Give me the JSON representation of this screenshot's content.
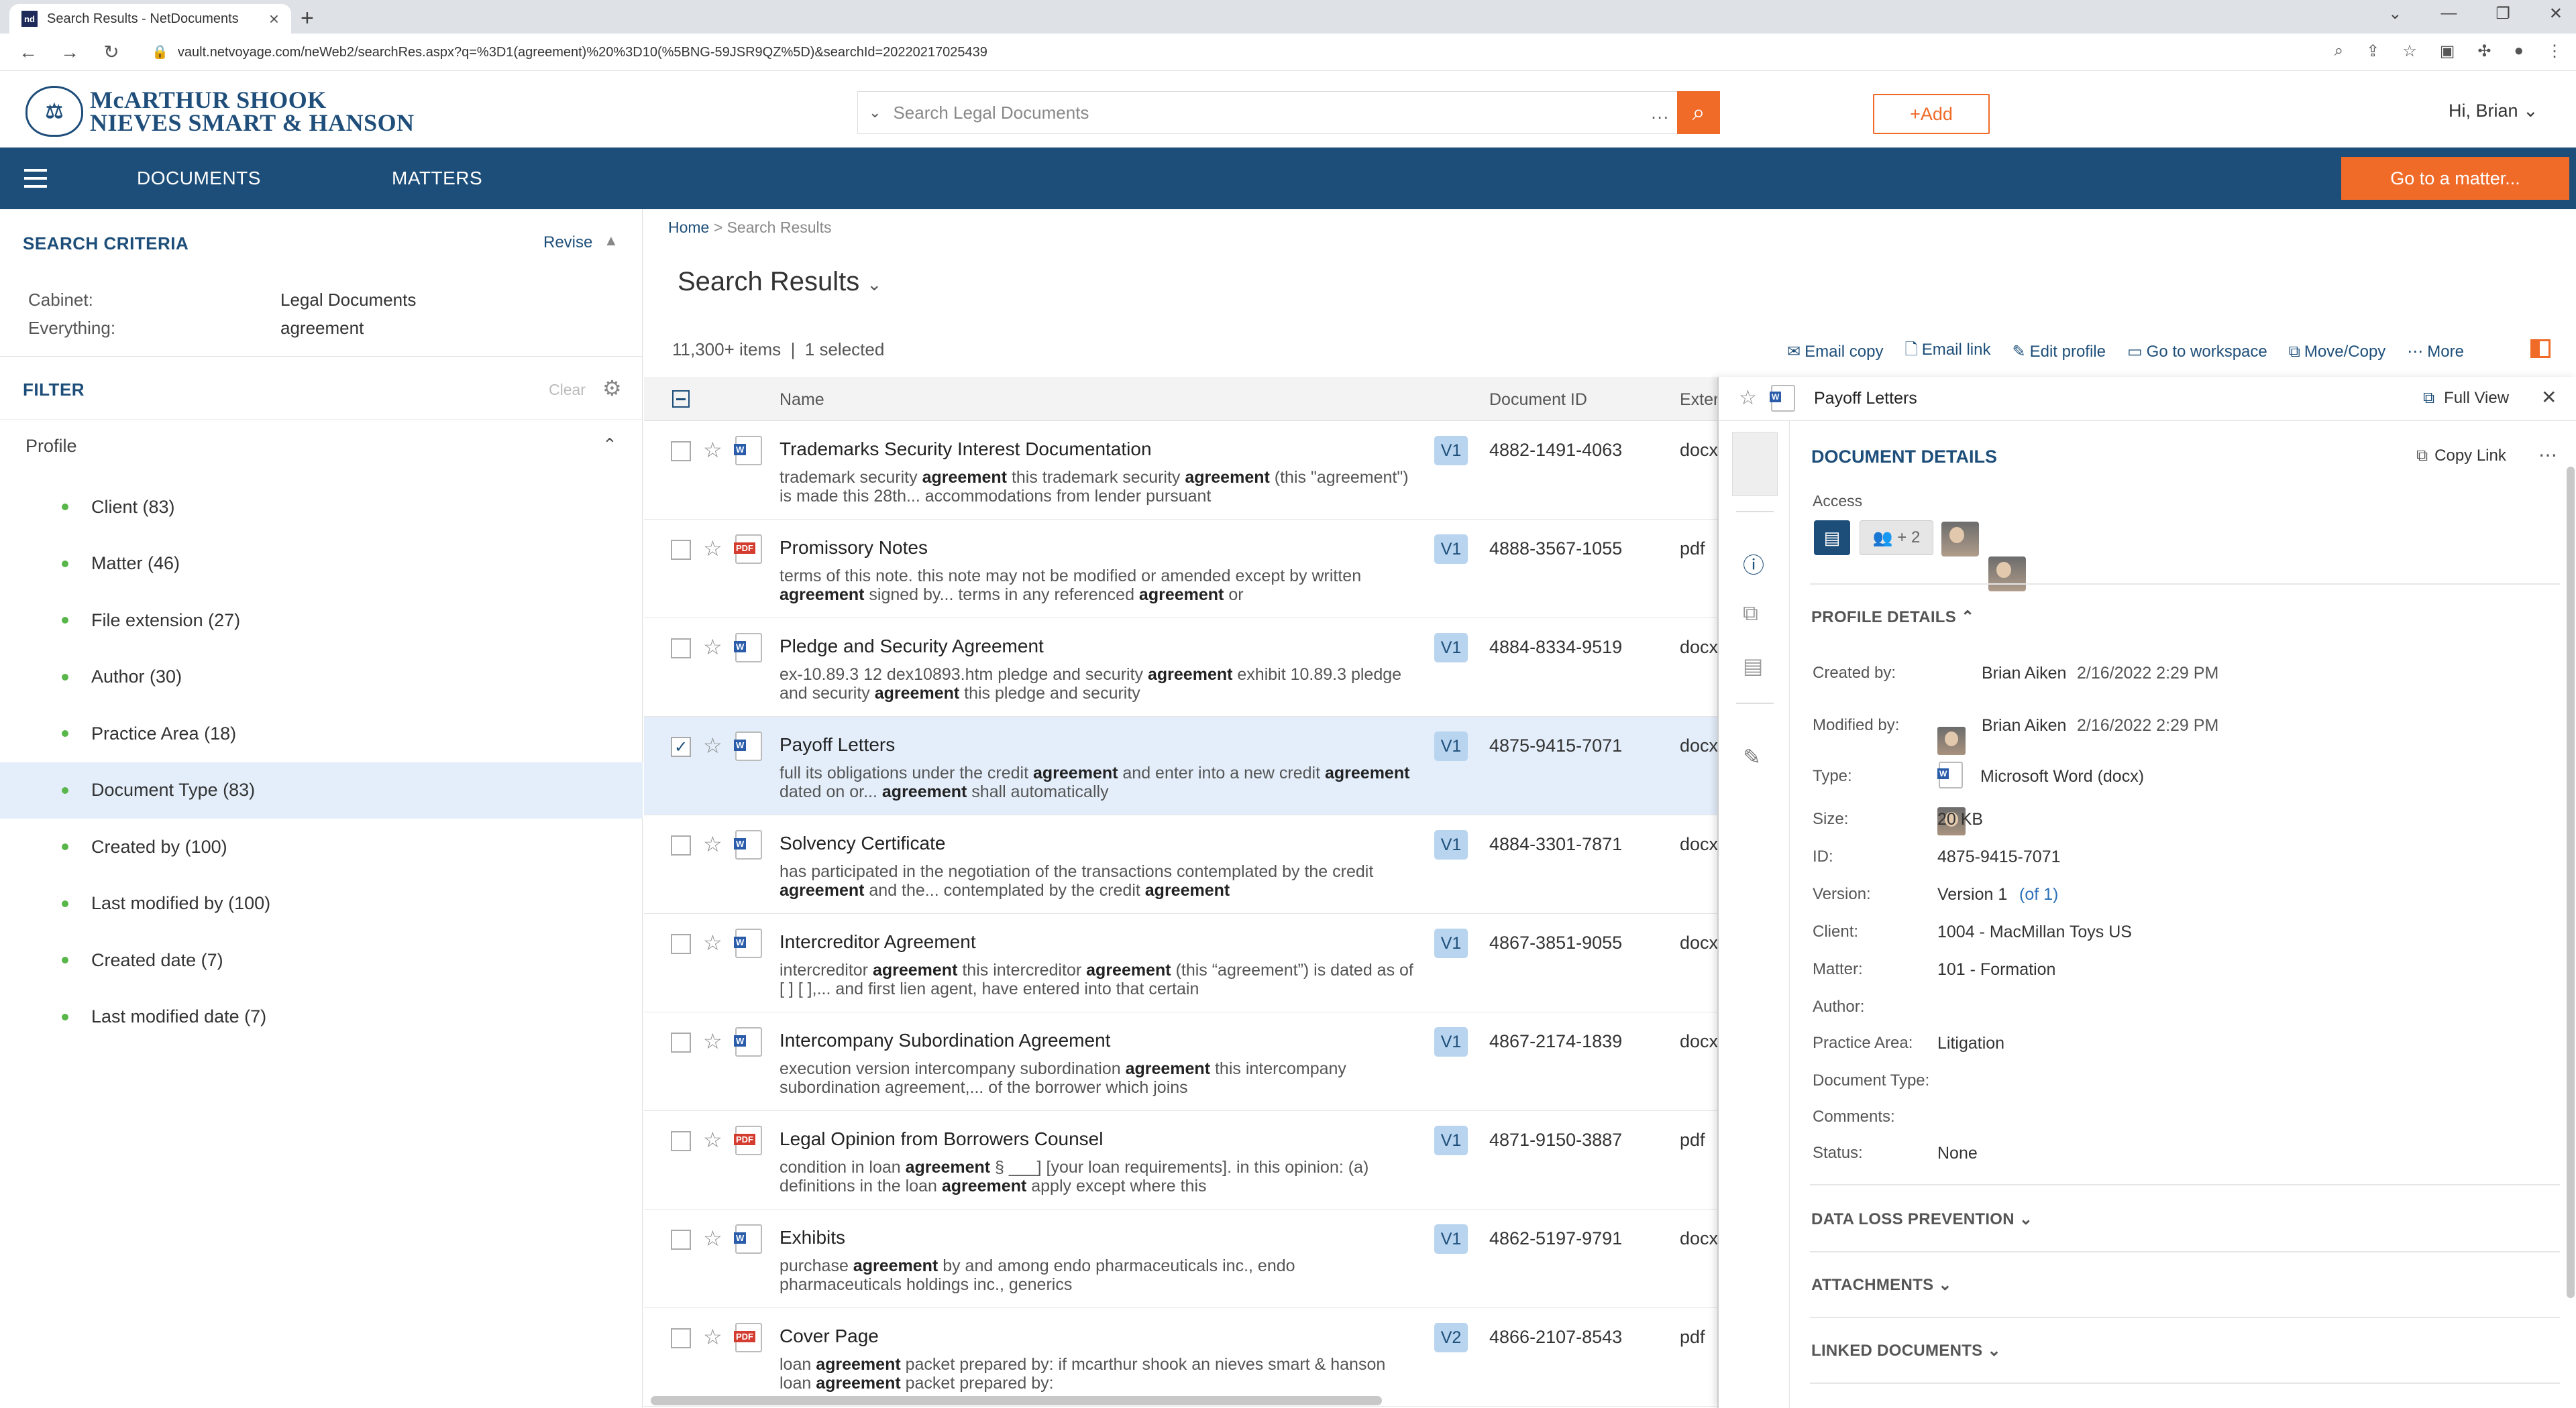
{
  "browser": {
    "tab_title": "Search Results - NetDocuments",
    "tab_favicon": "nd",
    "url": "vault.netvoyage.com/neWeb2/searchRes.aspx?q=%3D1(agreement)%20%3D10(%5BNG-59JSR9QZ%5D)&searchId=20220217025439"
  },
  "header": {
    "firm_line1": "McARTHUR SHOOK",
    "firm_line2": "NIEVES SMART & HANSON",
    "search_placeholder": "Search Legal Documents",
    "search_more": "...",
    "add_label": "+Add",
    "greeting": "Hi, Brian"
  },
  "nav": {
    "documents": "DOCUMENTS",
    "matters": "MATTERS",
    "go_to_matter": "Go to a matter..."
  },
  "criteria": {
    "title": "SEARCH CRITERIA",
    "revise": "Revise",
    "rows": [
      {
        "label": "Cabinet:",
        "value": "Legal Documents"
      },
      {
        "label": "Everything:",
        "value": "agreement"
      }
    ]
  },
  "filter": {
    "title": "FILTER",
    "clear": "Clear",
    "profile_label": "Profile",
    "items": [
      "Client (83)",
      "Matter (46)",
      "File extension (27)",
      "Author (30)",
      "Practice Area (18)",
      "Document Type (83)",
      "Created by (100)",
      "Last modified by (100)",
      "Created date (7)",
      "Last modified date (7)"
    ]
  },
  "main": {
    "breadcrumb_home": "Home",
    "breadcrumb_sep": " > ",
    "breadcrumb_current": "Search Results",
    "title": "Search Results",
    "count": "11,300+ items",
    "selected": "1 selected",
    "actions": [
      "Email copy",
      "Email link",
      "Edit profile",
      "Go to workspace",
      "Move/Copy",
      "More"
    ],
    "columns": {
      "name": "Name",
      "docid": "Document ID",
      "ext": "Exter"
    }
  },
  "rows": [
    {
      "name": "Trademarks Security Interest Documentation",
      "type": "w",
      "ver": "V1",
      "id": "4882-1491-4063",
      "ext": "docx",
      "selected": false,
      "snippet": "trademark security <b>agreement</b> this trademark security <b>agreement</b> (this \"agreement\") is made this 28th... accommodations from lender pursuant"
    },
    {
      "name": "Promissory Notes",
      "type": "p",
      "ver": "V1",
      "id": "4888-3567-1055",
      "ext": "pdf",
      "selected": false,
      "snippet": "terms of this note. this note may not be modified or amended except by written <b>agreement</b> signed by... terms in any referenced <b>agreement</b> or"
    },
    {
      "name": "Pledge and Security Agreement",
      "type": "w",
      "ver": "V1",
      "id": "4884-8334-9519",
      "ext": "docx",
      "selected": false,
      "snippet": "ex-10.89.3 12 dex10893.htm pledge and security <b>agreement</b> exhibit 10.89.3 pledge and security <b>agreement</b> this pledge and security"
    },
    {
      "name": "Payoff Letters",
      "type": "w",
      "ver": "V1",
      "id": "4875-9415-7071",
      "ext": "docx",
      "selected": true,
      "snippet": "full its obligations under the credit <b>agreement</b> and enter into a new credit <b>agreement</b> dated on or... <b>agreement</b> shall automatically"
    },
    {
      "name": "Solvency Certificate",
      "type": "w",
      "ver": "V1",
      "id": "4884-3301-7871",
      "ext": "docx",
      "selected": false,
      "snippet": "has participated in the negotiation of the transactions contemplated by the credit <b>agreement</b> and the... contemplated by the credit <b>agreement</b>"
    },
    {
      "name": "Intercreditor Agreement",
      "type": "w",
      "ver": "V1",
      "id": "4867-3851-9055",
      "ext": "docx",
      "selected": false,
      "snippet": "intercreditor <b>agreement</b> this intercreditor <b>agreement</b> (this “agreement”) is dated as of [ ] [ ],... and first lien agent, have entered into that certain"
    },
    {
      "name": "Intercompany Subordination Agreement",
      "type": "w",
      "ver": "V1",
      "id": "4867-2174-1839",
      "ext": "docx",
      "selected": false,
      "snippet": "execution version intercompany subordination <b>agreement</b> this intercompany subordination agreement,... of the borrower which joins"
    },
    {
      "name": "Legal Opinion from Borrowers Counsel",
      "type": "p",
      "ver": "V1",
      "id": "4871-9150-3887",
      "ext": "pdf",
      "selected": false,
      "snippet": "condition in loan <b>agreement</b> § ___] [your loan requirements]. in this opinion: (a) definitions in the loan <b>agreement</b> apply except where this"
    },
    {
      "name": "Exhibits",
      "type": "w",
      "ver": "V1",
      "id": "4862-5197-9791",
      "ext": "docx",
      "selected": false,
      "snippet": "purchase <b>agreement</b> by and among endo pharmaceuticals inc., endo pharmaceuticals holdings inc., generics"
    },
    {
      "name": "Cover Page",
      "type": "p",
      "ver": "V2",
      "id": "4866-2107-8543",
      "ext": "pdf",
      "selected": false,
      "snippet": "loan <b>agreement</b> packet prepared by: if mcarthur shook an nieves smart &amp; hanson loan <b>agreement</b> packet prepared by:"
    }
  ],
  "details": {
    "doc_title": "Payoff Letters",
    "full_view": "Full View",
    "section_title": "DOCUMENT DETAILS",
    "copy_link": "Copy Link",
    "access_label": "Access",
    "access_more": "+ 2",
    "profile_details": "PROFILE DETAILS",
    "created_by_label": "Created by:",
    "created_by": "Brian Aiken",
    "created_date": "2/16/2022 2:29 PM",
    "modified_by_label": "Modified by:",
    "modified_by": "Brian Aiken",
    "modified_date": "2/16/2022 2:29 PM",
    "fields": [
      {
        "label": "Type:",
        "value": "Microsoft Word (docx)"
      },
      {
        "label": "Size:",
        "value": "20 KB"
      },
      {
        "label": "ID:",
        "value": "4875-9415-7071"
      },
      {
        "label": "Version:",
        "value": "Version 1"
      },
      {
        "label": "Client:",
        "value": "1004 - MacMillan Toys US"
      },
      {
        "label": "Matter:",
        "value": "101 - Formation"
      },
      {
        "label": "Author:",
        "value": ""
      },
      {
        "label": "Practice Area:",
        "value": "Litigation"
      },
      {
        "label": "Document Type:",
        "value": ""
      },
      {
        "label": "Comments:",
        "value": ""
      },
      {
        "label": "Status:",
        "value": "None"
      }
    ],
    "version_of": "(of 1)",
    "dlp": "DATA LOSS PREVENTION",
    "attachments": "ATTACHMENTS",
    "linked": "LINKED DOCUMENTS"
  },
  "colors": {
    "brand_blue": "#1d4e79",
    "accent_orange": "#f06a28",
    "selected_row": "#e3eefa",
    "filter_dot": "#59b64a"
  }
}
